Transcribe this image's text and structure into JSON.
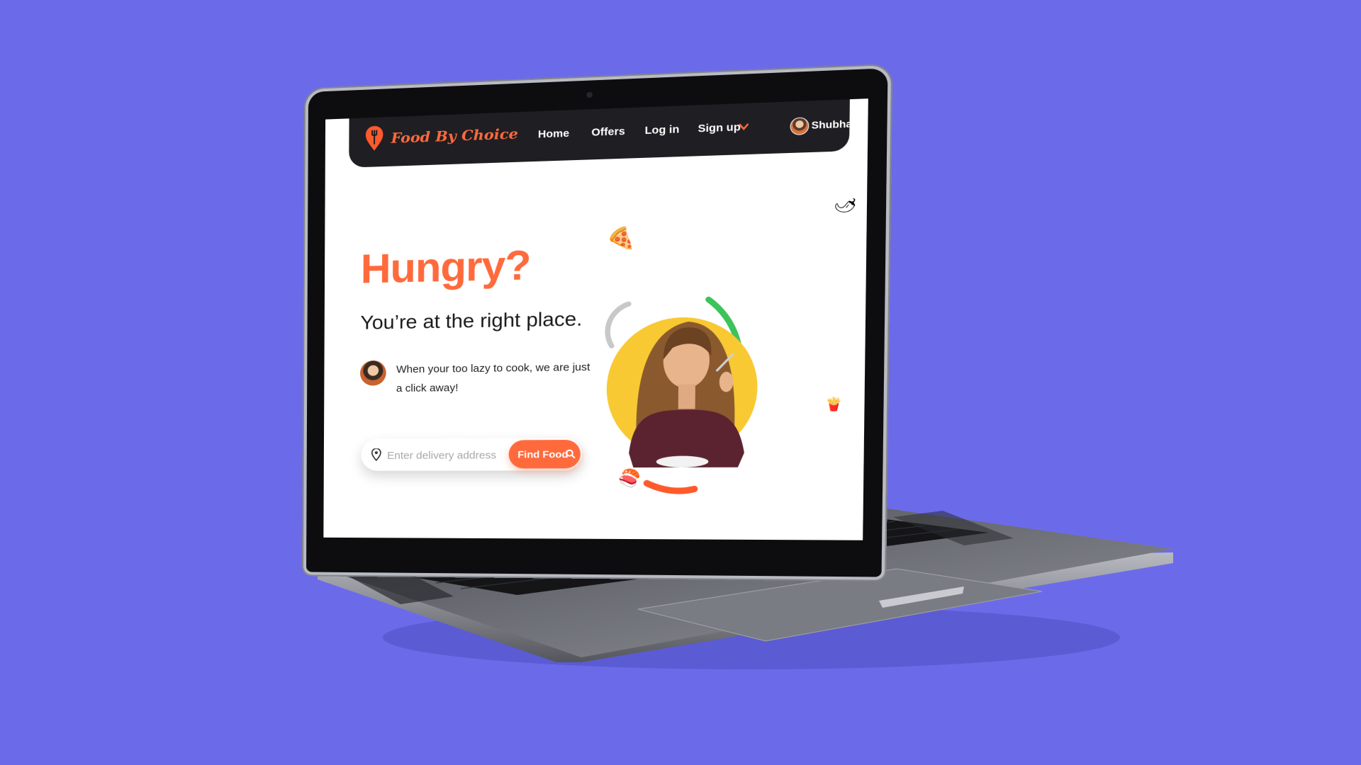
{
  "brand": {
    "name": "Food By Choice",
    "accent": "#ff6a3d",
    "logo_icon": "fork-pin-icon"
  },
  "nav": {
    "items": [
      {
        "label": "Home"
      },
      {
        "label": "Offers"
      },
      {
        "label": "Log in"
      },
      {
        "label": "Sign up"
      }
    ],
    "signup_icon": "chevron-down-icon",
    "user": {
      "name": "Shubham",
      "avatar": "avatar"
    }
  },
  "hero": {
    "title": "Hungry?",
    "subtitle": "You’re at the right place.",
    "tagline": "When your too lazy to cook, we are just a click away!"
  },
  "search": {
    "placeholder": "Enter delivery address",
    "value": "",
    "icon": "location-pin-icon",
    "button_label": "Find Food",
    "button_icon": "search-icon"
  },
  "decor": {
    "icons": [
      "pizza-icon",
      "chili-icon",
      "fries-icon",
      "sushi-icon"
    ],
    "circle_color": "#f8c933",
    "arc_colors": [
      "#c8c8c8",
      "#3cc35a",
      "#ff5a2c"
    ]
  },
  "background_color": "#6b6bea"
}
